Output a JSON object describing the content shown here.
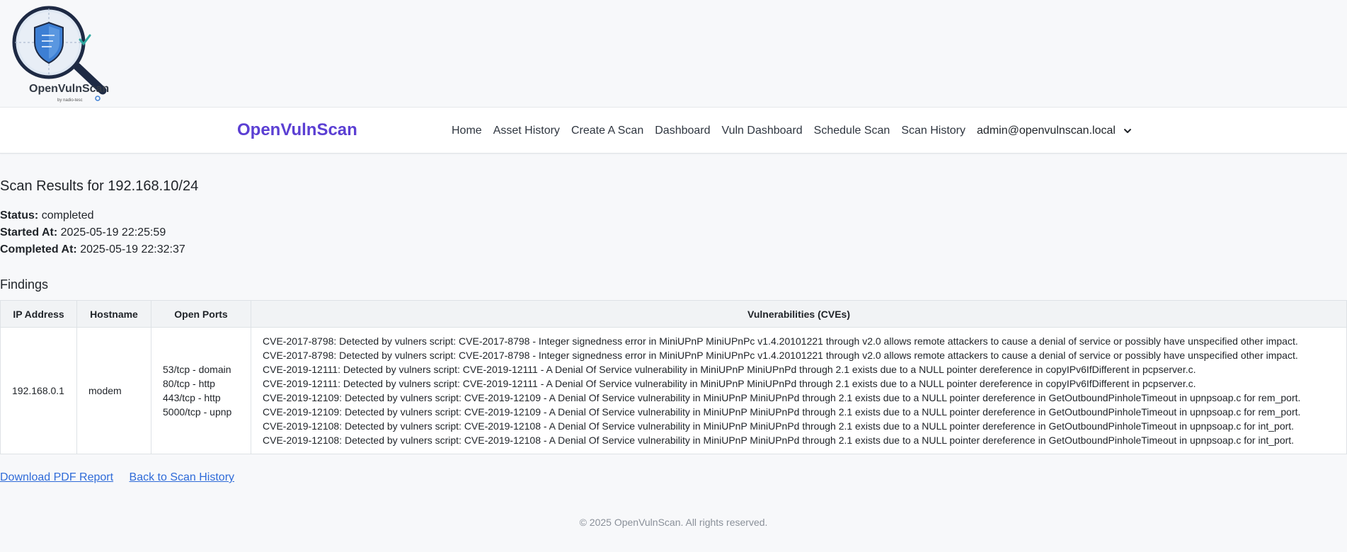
{
  "logo": {
    "name": "OpenVulnScan",
    "byline": "by nadio-tesc"
  },
  "navbar": {
    "brand": "OpenVulnScan",
    "links": [
      "Home",
      "Asset History",
      "Create A Scan",
      "Dashboard",
      "Vuln Dashboard",
      "Schedule Scan",
      "Scan History"
    ],
    "user": "admin@openvulnscan.local"
  },
  "page": {
    "title": "Scan Results for 192.168.10/24",
    "status_label": "Status:",
    "status_value": "completed",
    "started_label": "Started At:",
    "started_value": "2025-05-19 22:25:59",
    "completed_label": "Completed At:",
    "completed_value": "2025-05-19 22:32:37",
    "findings_title": "Findings"
  },
  "table": {
    "headers": [
      "IP Address",
      "Hostname",
      "Open Ports",
      "Vulnerabilities (CVEs)"
    ],
    "rows": [
      {
        "ip": "192.168.0.1",
        "hostname": "modem",
        "ports": [
          "53/tcp - domain",
          "80/tcp - http",
          "443/tcp - http",
          "5000/tcp - upnp"
        ],
        "vulns": [
          "CVE-2017-8798: Detected by vulners script: CVE-2017-8798 - Integer signedness error in MiniUPnP MiniUPnPc v1.4.20101221 through v2.0 allows remote attackers to cause a denial of service or possibly have unspecified other impact.",
          "CVE-2017-8798: Detected by vulners script: CVE-2017-8798 - Integer signedness error in MiniUPnP MiniUPnPc v1.4.20101221 through v2.0 allows remote attackers to cause a denial of service or possibly have unspecified other impact.",
          "CVE-2019-12111: Detected by vulners script: CVE-2019-12111 - A Denial Of Service vulnerability in MiniUPnP MiniUPnPd through 2.1 exists due to a NULL pointer dereference in copyIPv6IfDifferent in pcpserver.c.",
          "CVE-2019-12111: Detected by vulners script: CVE-2019-12111 - A Denial Of Service vulnerability in MiniUPnP MiniUPnPd through 2.1 exists due to a NULL pointer dereference in copyIPv6IfDifferent in pcpserver.c.",
          "CVE-2019-12109: Detected by vulners script: CVE-2019-12109 - A Denial Of Service vulnerability in MiniUPnP MiniUPnPd through 2.1 exists due to a NULL pointer dereference in GetOutboundPinholeTimeout in upnpsoap.c for rem_port.",
          "CVE-2019-12109: Detected by vulners script: CVE-2019-12109 - A Denial Of Service vulnerability in MiniUPnP MiniUPnPd through 2.1 exists due to a NULL pointer dereference in GetOutboundPinholeTimeout in upnpsoap.c for rem_port.",
          "CVE-2019-12108: Detected by vulners script: CVE-2019-12108 - A Denial Of Service vulnerability in MiniUPnP MiniUPnPd through 2.1 exists due to a NULL pointer dereference in GetOutboundPinholeTimeout in upnpsoap.c for int_port.",
          "CVE-2019-12108: Detected by vulners script: CVE-2019-12108 - A Denial Of Service vulnerability in MiniUPnP MiniUPnPd through 2.1 exists due to a NULL pointer dereference in GetOutboundPinholeTimeout in upnpsoap.c for int_port."
        ]
      }
    ]
  },
  "actions": {
    "download_pdf": "Download PDF Report",
    "back": "Back to Scan History"
  },
  "footer": "© 2025 OpenVulnScan. All rights reserved.",
  "colors": {
    "brand": "#5b3fd3",
    "link": "#2f6bd8",
    "background": "#f7f8fa"
  },
  "icons": [
    "logo-magnifier-shield-icon",
    "chevron-down-icon"
  ]
}
